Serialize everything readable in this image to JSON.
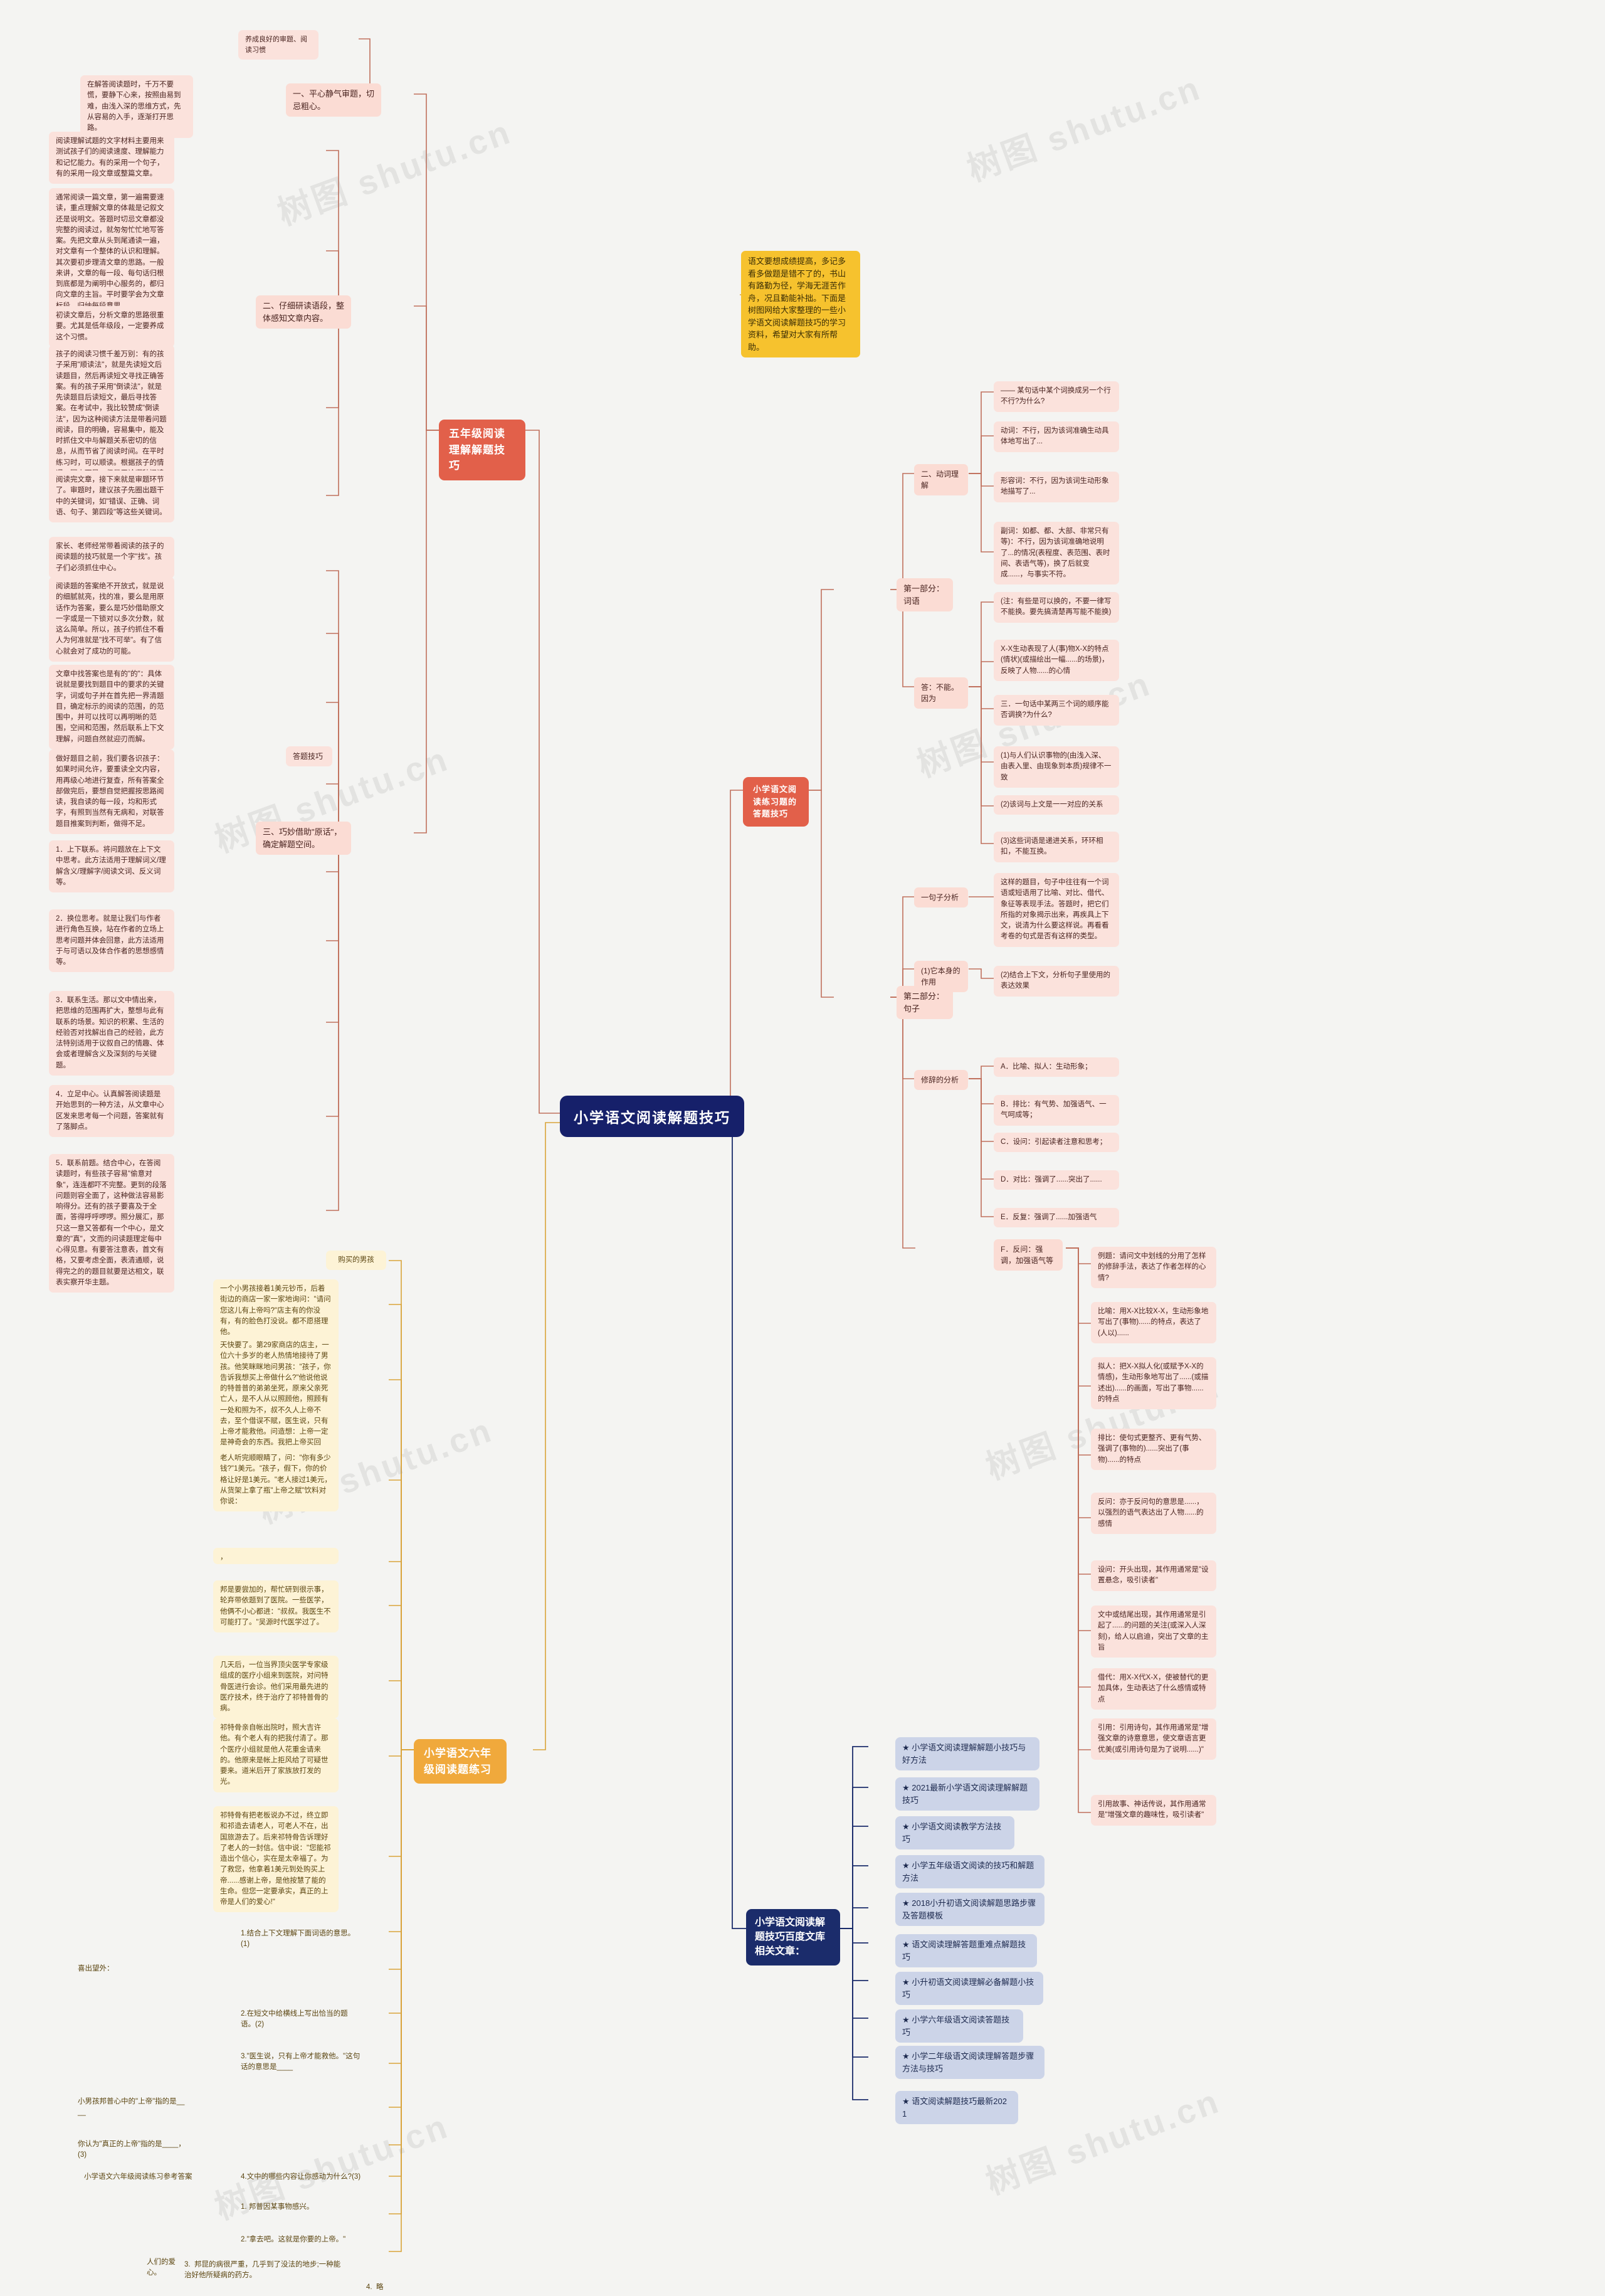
{
  "root": {
    "label": "小学语文阅读解题技巧"
  },
  "watermarks": [
    "树图 shutu.cn",
    "树图 shutu.cn",
    "树图 shutu.cn",
    "树图 shutu.cn",
    "树图 shutu.cn",
    "树图 shutu.cn",
    "树图 shutu.cn",
    "树图 shutu.cn"
  ],
  "branch_five": {
    "label": "五年级阅读理解解题技巧",
    "sections": [
      {
        "label": "一、平心静气审题，切忌粗心。",
        "lead": "养成良好的审题、阅读习惯",
        "details": [
          "在解答阅读题时，千万不要慌，要静下心来，按照由易到难，由浅入深的思维方式，先从容易的入手，逐渐打开思路。"
        ]
      },
      {
        "label": "二、仔细研读语段，整体感知文章内容。",
        "details": [
          "阅读理解试题的文字材料主要用来测试孩子们的阅读速度、理解能力和记忆能力。有的采用一个句子，有的采用一段文章或整篇文章。",
          "通常阅读一篇文章，第一遍需要速读，重点理解文章的体裁是记叙文还是说明文。答题时切忌文章都没完整的阅读过，就匆匆忙忙地写答案。先把文章从头到尾通读一遍，对文章有一个整体的认识和理解。其次要初步理清文章的思路。一般来讲，文章的每一段、每句话归根到底都是为阐明中心服务的，都归向文章的主旨。平时要学会为文章标段，归纳每段意思。",
          "初读文章后，分析文章的思路很重要。尤其是低年级段，一定要养成这个习惯。",
          "孩子的阅读习惯千差万别：有的孩子采用\"顺读法\"，就是先读短文后读题目，然后再读短文寻找正确答案。有的孩子采用\"倒读法\"，就是先读题目后读短文，最后寻找答案。在考试中，我比较赞成\"倒读法\"，因为这种阅读方法是带着问题阅读，目的明确，容易集中，能及时抓住文中与解题关系密切的信息，从而节省了阅读时间。在平时练习时，可以顺读。根据孩子的情况，因人而异，但是无论哪种阅读方法，都要强调：有效阅读。",
          "阅读完文章，接下来就是审题环节了。审题时，建议孩子先圈出题干中的关键词，如\"错误、正确、词语、句子、第四段\"等这些关键词。"
        ]
      },
      {
        "label": "三、巧妙借助\"原话\"，确定解题空间。",
        "lead": "答题技巧",
        "details": [
          "家长、老师经常带着阅读的孩子的阅读题的技巧就是一个字\"找\"。孩子们必须抓住中心。",
          "阅读题的答案绝不开放式，就是说的细腻就亮，找的准，要么是用原话作为答案，要么是巧妙借助原文一字或是一下锁对以多次分数，就这么简单。所以，孩子约抓住不看人为何准就是\"找不可举\"。有了信心就会对了成功的可能。",
          "文章中找答案也是有的\"的\"：具体说就是要找到题目中的要求的关键字，词或句子并在首先把一界清题目，确定标示的阅读的范围，的范围中，并可以找可以再明晰的范围，空间和范围，然后联系上下文理解，问题自然就迎刃而解。",
          "做好题目之前，我们要各识孩子：如果时间允许，要重读全文内容，用再级心地进行复查，所有答案全部做完后，要想自觉把握按思路阅读，我自读的每一段，均和形式字，有照到当然有无病和，对联答题目推案到判断，做得不足。",
          "1．上下联系。将问题放在上下文中思考。此方法适用于理解词义/理解含义/理解字/阅读文词、反义词等。",
          "2．换位思考。就是让我们与作者进行角色互换，站在作者的立场上思考问题并体会回意，此方法适用于与可语以及体合作者的思想感情等。",
          "3．联系生活。那以文中情出来，把思维的范围再扩大，整想与此有联系的场景。知识的积累、生活的经验否对找解出自己的经验，此方法特别适用于议叙自己的情趣、体会或者理解含义及深刻的与关键题。",
          "4．立足中心。认真解答阅读题是开始思到的一种方法，从文章中心区发来思考每一个问题，答案就有了落脚点。",
          "5．联系前题。结合中心，在答阅读题时，有些孩子容易\"偷意对象\"，连连都吓不完整。更到的段落问题则容全面了，这种做法容易影响得分。还有的孩子要喜及于全面，答得呼呼啰啰。照分展汇，那只这一意又答都有一个中心，是文章的\"真\"，文而的问读题理定每中心得见意。有要答注意表，首文有格，又要考虑全面，表清通顺，说得完之的的题目就要是达相文，联表实察开华主题。"
        ]
      }
    ]
  },
  "branch_practice": {
    "label": "小学语文六年级阅读题练习",
    "items": [
      {
        "text": "购买的男孩"
      },
      {
        "text": "一个小男孩接着1美元钞币，后着街边的商店一家一家地询问：\"请问您这儿有上帝吗?\"店主有的你没有，有的脸色打没说。都不愿搭理他。"
      },
      {
        "text": "天快要了。第29家商店的店主，一位六十多岁的老人热情地接待了男孩。他笑眯眯地问男孩：\"孩子，你告诉我想买上帝做什么?\"他说他说的特普普的弟弟坐死，原来父亲死亡人，是不人从以照顾他，照顾有一处和照为不，叔不久人上帝不去，至个借误不赋，医生说，只有上帝才能救他。问造想：上帝一定是神奇会的东西。我把上帝买回来，让叔叔吃了，他就会好的。"
      },
      {
        "text": "老人听完顺眼睛了，问：\"你有多少钱?\"1美元。\"孩子，假下，你的价格让好是1美元。\"老人接过1美元，从货架上拿了瓶\"上帝之赋\"饮料对你说："
      },
      {
        "text": "，"
      },
      {
        "text": "邦是要尝加的，帮忙研到很示事，轮弃带依题到了医院。一些医学，他俩不小心都进：\"叔叔。我医生不可能打了。\"吴源时代医学过了。"
      },
      {
        "text": "几天后，一位当界顶尖医学专家级组成的医疗小组来到医院，对问特骨医进行会诊。他们采用最先进的医疗技术，终于治疗了祁特普骨的病。"
      },
      {
        "text": "祁特骨亲自帐出院时，照大吉许他。有个老人有的把我付清了。那个医疗小组就是他人花重金请来的。他原来是帐上拒风给了可疑世要来。道米后开了家族放打发的光。"
      },
      {
        "text": "祁特骨有把老板说办不过，终立即和祁造去请老人，可老人不在，出国旅游去了。后来祁特骨告诉理好了老人的一封信。信中说：\"您能祁造出个信心，实在是太幸福了。为了救您，他拿着1美元到处购买上帝......感谢上帝，是他按慧了能的生命。但您一定要承实，真正的上帝是人们的爱心!\""
      },
      {
        "text": "1.结合上下文理解下面词语的意思。(1)"
      },
      {
        "text": "喜出望外："
      },
      {
        "text": "2.在短文中给横线上写出恰当的题语。(2)"
      },
      {
        "text": "3.\"医生说，只有上帝才能救他。\"这句话的意思是____"
      },
      {
        "text": "小男孩邦普心中的\"上帝\"指的是____"
      },
      {
        "text": "你认为\"真正的上帝\"指的是____，(3)"
      },
      {
        "text": "小学语文六年级阅读练习参考答案"
      },
      {
        "text": "4.文中的哪些内容让你感动为什么?(3)"
      },
      {
        "text": "1. 邦普因某事物感兴。"
      },
      {
        "text": "2.\"拿去吧。这就是你要的上帝。\""
      },
      {
        "text": "3.  邦昆的病很严重，几乎到了没法的地步;一种能治好他所疑病的药方。"
      },
      {
        "text": "人们的爱心。"
      },
      {
        "text": "4.  略"
      }
    ]
  },
  "branch_answer": {
    "label": "小学语文阅读练习题的答题技巧",
    "part1": {
      "label": "第一部分：词语",
      "subs": [
        {
          "label": "二、动词理解",
          "details": [
            "—— 某句话中某个词换成另一个行不行?为什么?",
            "动词：不行，因为该词准确生动具体地写出了...",
            "形容词：不行，因为该词生动形象地描写了...",
            "副词：如都、都、大部、非常只有等)：不行，因为该词准确地说明了...的情况(表程度、表范围、表时间、表语气等)，换了后就变成......，与事实不符。"
          ]
        },
        {
          "label": "答：不能。因为",
          "details": [
            "(注：有些是可以换的，不要一律写不能换。要先搞清楚再写能不能换)",
            "X-X生动表现了人(事)物X-X的特点(情状)(或描绘出一幅......的场景)，反映了人物......的心情",
            "三．一句话中某两三个词的顺序能否调换?为什么?",
            "(1)与人们认识事物的(由浅入深、由表入里、由现象到本质)规律不一致",
            "(2)该词与上文是一一对应的关系",
            "(3)这些词语是递进关系，环环相扣，不能互换。"
          ]
        }
      ]
    },
    "part2": {
      "label": "第二部分：句子",
      "subs": [
        {
          "label": "一句子分析",
          "details": [
            "这样的题目，句子中往往有一个词语或短语用了比喻、对比、借代、象征等表现手法。答题时，把它们所指的对象揭示出来，再疾具上下文，说清为什么要这样说。再看看考卷的句式是否有这样的类型。"
          ]
        },
        {
          "label": "(1)它本身的作用",
          "details": [
            "(2)结合上下文，分析句子里使用的表达效果"
          ]
        },
        {
          "label": "修辞的分析",
          "details": [
            "A．比喻、拟人：生动形象；",
            "B．排比：有气势、加强语气、一气呵成等；",
            "C．设问：引起读者注意和思考；",
            "D．对比：强调了......突出了......",
            "E．反复：强调了......加强语气"
          ]
        },
        {
          "label": "F．反问：强调，加强语气等",
          "details": [
            "例题：请问文中划线的分用了怎样的修辞手法，表达了作者怎样的心情?",
            "比喻：用X-X比较X-X，生动形象地写出了(事物)......的特点，表达了(人以)......",
            "拟人：把X-X拟人化(或赋予X-X的情感)，生动形象地写出了......(或描述出)......的画面，写出了事物......的特点",
            "排比：使句式更整齐、更有气势、强调了(事物的)......突出了(事物)......的特点",
            "反问：亦于反问句的意思是......，以强烈的语气表达出了人物......的感情",
            "设问：开头出现，其作用通常是\"设置悬念，吸引读者\"",
            "文中或结尾出现，其作用通常是引起了......的问题的关注(或深入人深刻)，给人以启迪，突出了文章的主旨",
            "借代：用X-X代X-X，使被替代的更加具体，生动表达了什么感情或特点",
            "引用：引用诗句，其作用通常是\"增强文章的诗意意思，使文章语言更优美(或引用诗句是为了说明......)\"",
            "引用故事、神话传说，其作用通常是\"增强文章的趣味性，吸引读者\""
          ]
        }
      ]
    }
  },
  "branch_baidu": {
    "label": "小学语文阅读解题技巧百度文库相关文章：",
    "items": [
      "★ 小学语文阅读理解解题小技巧与好方法",
      "★ 2021最新小学语文阅读理解解题技巧",
      "★ 小学语文阅读教学方法技巧",
      "★ 小学五年级语文阅读的技巧和解题方法",
      "★ 2018小升初语文阅读解题思路步骤及答题模板",
      "★ 语文阅读理解答题重难点解题技巧",
      "★ 小升初语文阅读理解必备解题小技巧",
      "★ 小学六年级语文阅读答题技巧",
      "★ 小学二年级语文阅读理解答题步骤方法与技巧",
      "★ 语文阅读解题技巧最新2021"
    ]
  },
  "intro_box": {
    "text": "语文要想成绩提高，多记多看多做题是错不了的，书山有路勤为径，学海无涯苦作舟，况且勤能补拙。下面是树图网给大家整理的一些小学语文阅读解题技巧的学习资料，希望对大家有所帮助。"
  },
  "colors": {
    "bg": "#f4f4f2",
    "root": "#16206a",
    "red_topic": "#e2604a",
    "amber_topic": "#f0a93c",
    "navy_topic": "#1b2c6b",
    "pink_node": "#fbe2dc",
    "amber_node": "#f6c22e",
    "blue_node": "#ccd4e8",
    "line_red": "#c0705c",
    "line_amber": "#d9a33a",
    "line_navy": "#1b2c6b"
  }
}
